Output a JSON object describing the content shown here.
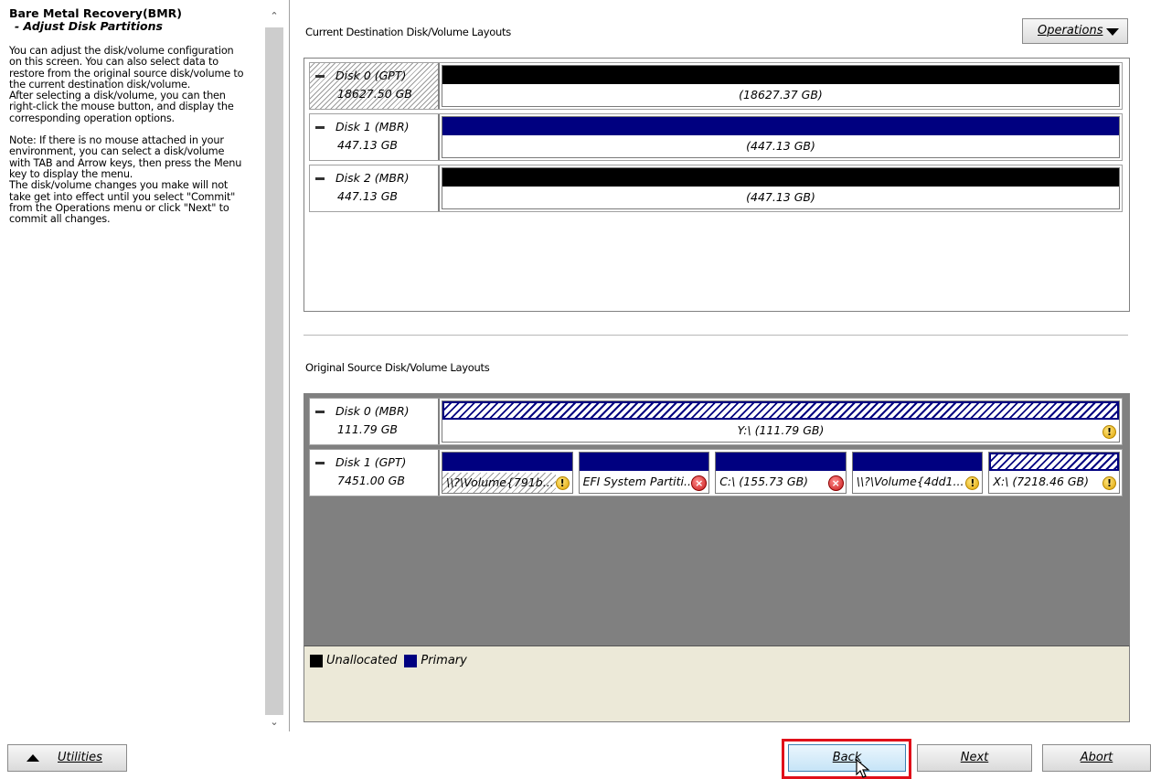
{
  "help": {
    "title": "Bare Metal Recovery(BMR)",
    "subtitle": "- Adjust Disk Partitions",
    "paragraph1": "You can adjust the disk/volume configuration\non this screen. You can also select data to\nrestore from the original source disk/volume to\nthe current destination disk/volume.\nAfter selecting a disk/volume, you can then\nright-click the mouse button, and display the\ncorresponding operation options.",
    "paragraph2": "Note: If there is no mouse attached in your\nenvironment, you can select a disk/volume\nwith TAB and Arrow keys, then press the Menu\nkey to display the menu.\nThe disk/volume changes you make will not\ntake get into effect until you select \"Commit\"\nfrom the Operations menu or click \"Next\" to\ncommit all changes."
  },
  "destination": {
    "label": "Current Destination Disk/Volume Layouts",
    "operations_label": "Operations",
    "disks": [
      {
        "name": "Disk 0 (GPT)",
        "size": "18627.50 GB",
        "volume": "(18627.37 GB)"
      },
      {
        "name": "Disk 1 (MBR)",
        "size": "447.13 GB",
        "volume": "(447.13 GB)"
      },
      {
        "name": "Disk 2 (MBR)",
        "size": "447.13 GB",
        "volume": "(447.13 GB)"
      }
    ]
  },
  "source": {
    "label": "Original Source Disk/Volume Layouts",
    "disks": [
      {
        "name": "Disk 0 (MBR)",
        "size": "111.79 GB",
        "volume": "Y:\\ (111.79 GB)"
      },
      {
        "name": "Disk 1 (GPT)",
        "size": "7451.00 GB",
        "volumes": [
          "\\\\?\\Volume{791b...",
          "EFI System Partiti...",
          "C:\\ (155.73 GB)",
          "\\\\?\\Volume{4dd1...",
          "X:\\ (7218.46 GB)"
        ]
      }
    ]
  },
  "legend": {
    "unallocated": "Unallocated",
    "primary": "Primary"
  },
  "buttons": {
    "utilities": "Utilities",
    "back": "Back",
    "next": "Next",
    "abort": "Abort"
  },
  "colors": {
    "unallocated": "#000000",
    "primary": "#000080",
    "highlight": "#e0101a",
    "panel_gray": "#808080"
  },
  "icons": {
    "warning": "warning-icon",
    "error": "error-icon",
    "scroll_up": "scroll-up-arrow-icon",
    "scroll_down": "scroll-down-arrow-icon",
    "cursor": "mouse-cursor-icon"
  }
}
